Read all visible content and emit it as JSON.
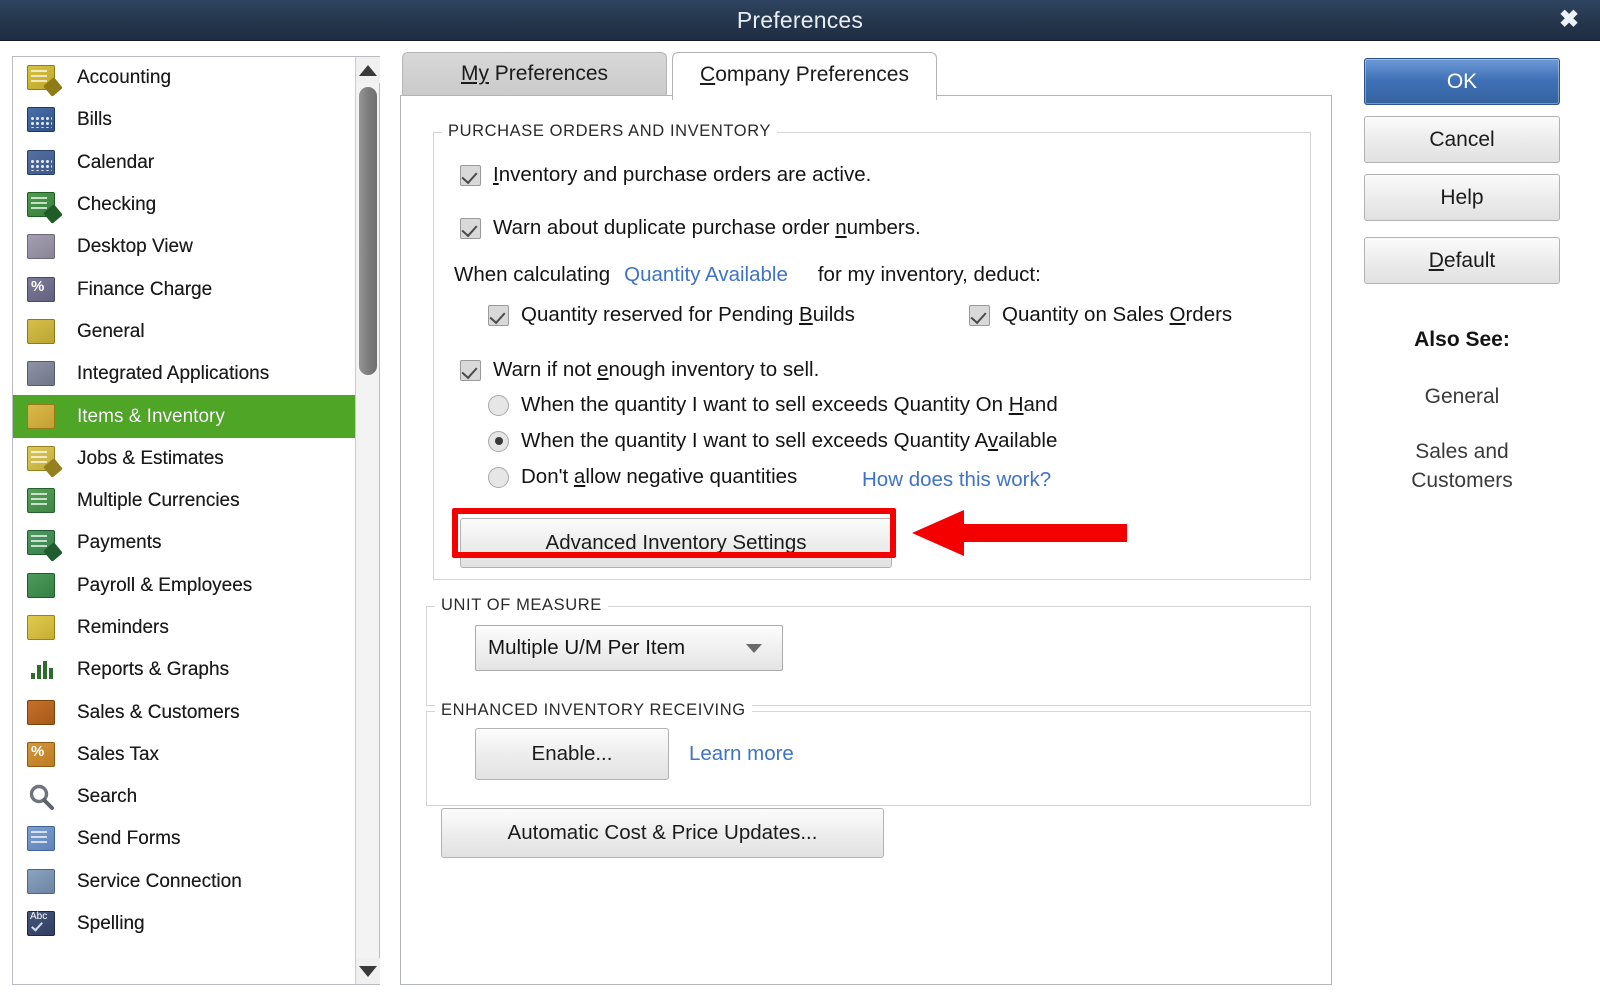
{
  "window": {
    "title": "Preferences",
    "close_label": "✖"
  },
  "sidebar": {
    "items": [
      {
        "label": "Accounting",
        "icon": "accounting-icon",
        "selected": false
      },
      {
        "label": "Bills",
        "icon": "bills-icon",
        "selected": false
      },
      {
        "label": "Calendar",
        "icon": "calendar-icon",
        "selected": false
      },
      {
        "label": "Checking",
        "icon": "checking-icon",
        "selected": false
      },
      {
        "label": "Desktop View",
        "icon": "desktop-view-icon",
        "selected": false
      },
      {
        "label": "Finance Charge",
        "icon": "finance-charge-icon",
        "selected": false
      },
      {
        "label": "General",
        "icon": "general-icon",
        "selected": false
      },
      {
        "label": "Integrated Applications",
        "icon": "integrated-applications-icon",
        "selected": false
      },
      {
        "label": "Items & Inventory",
        "icon": "items-inventory-icon",
        "selected": true
      },
      {
        "label": "Jobs & Estimates",
        "icon": "jobs-estimates-icon",
        "selected": false
      },
      {
        "label": "Multiple Currencies",
        "icon": "multiple-currencies-icon",
        "selected": false
      },
      {
        "label": "Payments",
        "icon": "payments-icon",
        "selected": false
      },
      {
        "label": "Payroll & Employees",
        "icon": "payroll-employees-icon",
        "selected": false
      },
      {
        "label": "Reminders",
        "icon": "reminders-icon",
        "selected": false
      },
      {
        "label": "Reports & Graphs",
        "icon": "reports-graphs-icon",
        "selected": false
      },
      {
        "label": "Sales & Customers",
        "icon": "sales-customers-icon",
        "selected": false
      },
      {
        "label": "Sales Tax",
        "icon": "sales-tax-icon",
        "selected": false
      },
      {
        "label": "Search",
        "icon": "search-icon",
        "selected": false
      },
      {
        "label": "Send Forms",
        "icon": "send-forms-icon",
        "selected": false
      },
      {
        "label": "Service Connection",
        "icon": "service-connection-icon",
        "selected": false
      },
      {
        "label": "Spelling",
        "icon": "spelling-icon",
        "selected": false
      }
    ]
  },
  "tabs": {
    "my_preferences": {
      "prefix": "",
      "mnemonic": "My",
      "suffix": " Preferences",
      "active": false
    },
    "company_preferences": {
      "mnemonic": "C",
      "suffix": "ompany Preferences",
      "active": true
    }
  },
  "purchase_orders_section": {
    "title": "PURCHASE ORDERS AND INVENTORY",
    "inventory_active": {
      "pre": "",
      "mnemonic": "I",
      "post": "nventory and purchase orders are active.",
      "checked": true
    },
    "warn_duplicate": {
      "pre": "Warn about duplicate purchase order ",
      "mnemonic": "n",
      "post": "umbers.",
      "checked": true
    },
    "when_calculating_prefix": "When calculating",
    "quantity_available_link": "Quantity Available",
    "when_calculating_suffix": "for my inventory, deduct:",
    "deduct_pending_builds": {
      "pre": "Quantity reserved for Pending ",
      "mnemonic": "B",
      "post": "uilds",
      "checked": true
    },
    "deduct_sales_orders": {
      "pre": "Quantity on Sales ",
      "mnemonic": "O",
      "post": "rders",
      "checked": true
    },
    "warn_not_enough": {
      "pre": "Warn if not ",
      "mnemonic": "e",
      "post": "nough inventory to sell.",
      "checked": true
    },
    "radios": [
      {
        "pre": "When the quantity I want to sell exceeds Quantity On ",
        "mnemonic": "H",
        "post": "and",
        "selected": false
      },
      {
        "pre": "When the quantity I want to sell exceeds Quantity A",
        "mnemonic": "v",
        "post": "ailable",
        "selected": true
      },
      {
        "pre": "Don't ",
        "mnemonic": "a",
        "post": "llow negative quantities",
        "selected": false
      }
    ],
    "how_does_this_work_link": "How does this work?",
    "advanced_inventory_settings_button": "Advanced Inventory Settings"
  },
  "unit_of_measure_section": {
    "title": "UNIT OF MEASURE",
    "selected_option": "Multiple U/M Per Item"
  },
  "enhanced_inventory_section": {
    "title": "ENHANCED INVENTORY RECEIVING",
    "enable_button": "Enable...",
    "learn_more_link": "Learn more"
  },
  "automatic_cost_price_button": "Automatic Cost & Price Updates...",
  "right_panel": {
    "ok_button": "OK",
    "cancel_button": "Cancel",
    "help_button": "Help",
    "default_button": {
      "mnemonic": "D",
      "post": "efault"
    },
    "also_see_title": "Also See:",
    "also_see_links": [
      "General",
      "Sales and\nCustomers"
    ]
  },
  "colors": {
    "titlebar": "#26384f",
    "selected_item": "#4fa526",
    "link": "#3f73c4",
    "annotation_red": "#f40000",
    "primary_button": "#3f70b6"
  }
}
